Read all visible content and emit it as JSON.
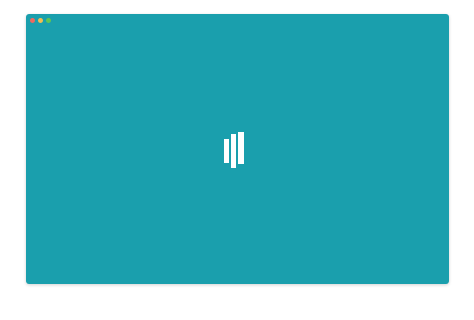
{
  "window": {
    "background": "#1a9fad",
    "controls": [
      {
        "name": "close",
        "color": "#ee6a5f"
      },
      {
        "name": "minimize",
        "color": "#f5bd4f"
      },
      {
        "name": "maximize",
        "color": "#61c454"
      }
    ]
  },
  "main": {
    "logo_icon": "three-vertical-bars-logo-icon",
    "logo_color": "#ffffff"
  }
}
